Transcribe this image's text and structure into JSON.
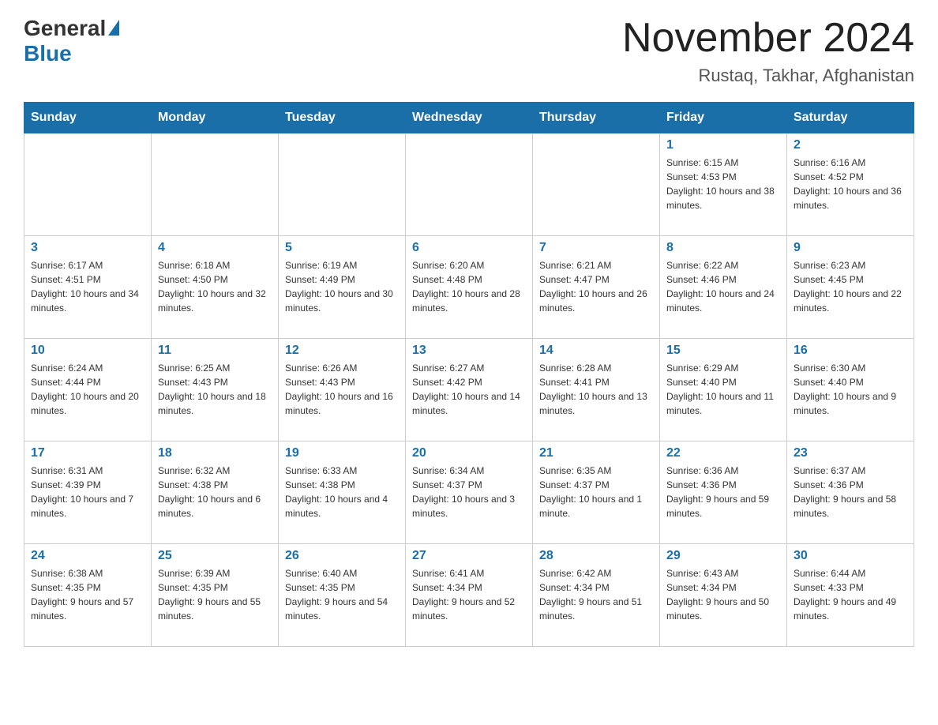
{
  "header": {
    "logo_general": "General",
    "logo_blue": "Blue",
    "title": "November 2024",
    "subtitle": "Rustaq, Takhar, Afghanistan"
  },
  "weekdays": [
    "Sunday",
    "Monday",
    "Tuesday",
    "Wednesday",
    "Thursday",
    "Friday",
    "Saturday"
  ],
  "weeks": [
    [
      {
        "day": "",
        "sunrise": "",
        "sunset": "",
        "daylight": ""
      },
      {
        "day": "",
        "sunrise": "",
        "sunset": "",
        "daylight": ""
      },
      {
        "day": "",
        "sunrise": "",
        "sunset": "",
        "daylight": ""
      },
      {
        "day": "",
        "sunrise": "",
        "sunset": "",
        "daylight": ""
      },
      {
        "day": "",
        "sunrise": "",
        "sunset": "",
        "daylight": ""
      },
      {
        "day": "1",
        "sunrise": "Sunrise: 6:15 AM",
        "sunset": "Sunset: 4:53 PM",
        "daylight": "Daylight: 10 hours and 38 minutes."
      },
      {
        "day": "2",
        "sunrise": "Sunrise: 6:16 AM",
        "sunset": "Sunset: 4:52 PM",
        "daylight": "Daylight: 10 hours and 36 minutes."
      }
    ],
    [
      {
        "day": "3",
        "sunrise": "Sunrise: 6:17 AM",
        "sunset": "Sunset: 4:51 PM",
        "daylight": "Daylight: 10 hours and 34 minutes."
      },
      {
        "day": "4",
        "sunrise": "Sunrise: 6:18 AM",
        "sunset": "Sunset: 4:50 PM",
        "daylight": "Daylight: 10 hours and 32 minutes."
      },
      {
        "day": "5",
        "sunrise": "Sunrise: 6:19 AM",
        "sunset": "Sunset: 4:49 PM",
        "daylight": "Daylight: 10 hours and 30 minutes."
      },
      {
        "day": "6",
        "sunrise": "Sunrise: 6:20 AM",
        "sunset": "Sunset: 4:48 PM",
        "daylight": "Daylight: 10 hours and 28 minutes."
      },
      {
        "day": "7",
        "sunrise": "Sunrise: 6:21 AM",
        "sunset": "Sunset: 4:47 PM",
        "daylight": "Daylight: 10 hours and 26 minutes."
      },
      {
        "day": "8",
        "sunrise": "Sunrise: 6:22 AM",
        "sunset": "Sunset: 4:46 PM",
        "daylight": "Daylight: 10 hours and 24 minutes."
      },
      {
        "day": "9",
        "sunrise": "Sunrise: 6:23 AM",
        "sunset": "Sunset: 4:45 PM",
        "daylight": "Daylight: 10 hours and 22 minutes."
      }
    ],
    [
      {
        "day": "10",
        "sunrise": "Sunrise: 6:24 AM",
        "sunset": "Sunset: 4:44 PM",
        "daylight": "Daylight: 10 hours and 20 minutes."
      },
      {
        "day": "11",
        "sunrise": "Sunrise: 6:25 AM",
        "sunset": "Sunset: 4:43 PM",
        "daylight": "Daylight: 10 hours and 18 minutes."
      },
      {
        "day": "12",
        "sunrise": "Sunrise: 6:26 AM",
        "sunset": "Sunset: 4:43 PM",
        "daylight": "Daylight: 10 hours and 16 minutes."
      },
      {
        "day": "13",
        "sunrise": "Sunrise: 6:27 AM",
        "sunset": "Sunset: 4:42 PM",
        "daylight": "Daylight: 10 hours and 14 minutes."
      },
      {
        "day": "14",
        "sunrise": "Sunrise: 6:28 AM",
        "sunset": "Sunset: 4:41 PM",
        "daylight": "Daylight: 10 hours and 13 minutes."
      },
      {
        "day": "15",
        "sunrise": "Sunrise: 6:29 AM",
        "sunset": "Sunset: 4:40 PM",
        "daylight": "Daylight: 10 hours and 11 minutes."
      },
      {
        "day": "16",
        "sunrise": "Sunrise: 6:30 AM",
        "sunset": "Sunset: 4:40 PM",
        "daylight": "Daylight: 10 hours and 9 minutes."
      }
    ],
    [
      {
        "day": "17",
        "sunrise": "Sunrise: 6:31 AM",
        "sunset": "Sunset: 4:39 PM",
        "daylight": "Daylight: 10 hours and 7 minutes."
      },
      {
        "day": "18",
        "sunrise": "Sunrise: 6:32 AM",
        "sunset": "Sunset: 4:38 PM",
        "daylight": "Daylight: 10 hours and 6 minutes."
      },
      {
        "day": "19",
        "sunrise": "Sunrise: 6:33 AM",
        "sunset": "Sunset: 4:38 PM",
        "daylight": "Daylight: 10 hours and 4 minutes."
      },
      {
        "day": "20",
        "sunrise": "Sunrise: 6:34 AM",
        "sunset": "Sunset: 4:37 PM",
        "daylight": "Daylight: 10 hours and 3 minutes."
      },
      {
        "day": "21",
        "sunrise": "Sunrise: 6:35 AM",
        "sunset": "Sunset: 4:37 PM",
        "daylight": "Daylight: 10 hours and 1 minute."
      },
      {
        "day": "22",
        "sunrise": "Sunrise: 6:36 AM",
        "sunset": "Sunset: 4:36 PM",
        "daylight": "Daylight: 9 hours and 59 minutes."
      },
      {
        "day": "23",
        "sunrise": "Sunrise: 6:37 AM",
        "sunset": "Sunset: 4:36 PM",
        "daylight": "Daylight: 9 hours and 58 minutes."
      }
    ],
    [
      {
        "day": "24",
        "sunrise": "Sunrise: 6:38 AM",
        "sunset": "Sunset: 4:35 PM",
        "daylight": "Daylight: 9 hours and 57 minutes."
      },
      {
        "day": "25",
        "sunrise": "Sunrise: 6:39 AM",
        "sunset": "Sunset: 4:35 PM",
        "daylight": "Daylight: 9 hours and 55 minutes."
      },
      {
        "day": "26",
        "sunrise": "Sunrise: 6:40 AM",
        "sunset": "Sunset: 4:35 PM",
        "daylight": "Daylight: 9 hours and 54 minutes."
      },
      {
        "day": "27",
        "sunrise": "Sunrise: 6:41 AM",
        "sunset": "Sunset: 4:34 PM",
        "daylight": "Daylight: 9 hours and 52 minutes."
      },
      {
        "day": "28",
        "sunrise": "Sunrise: 6:42 AM",
        "sunset": "Sunset: 4:34 PM",
        "daylight": "Daylight: 9 hours and 51 minutes."
      },
      {
        "day": "29",
        "sunrise": "Sunrise: 6:43 AM",
        "sunset": "Sunset: 4:34 PM",
        "daylight": "Daylight: 9 hours and 50 minutes."
      },
      {
        "day": "30",
        "sunrise": "Sunrise: 6:44 AM",
        "sunset": "Sunset: 4:33 PM",
        "daylight": "Daylight: 9 hours and 49 minutes."
      }
    ]
  ]
}
